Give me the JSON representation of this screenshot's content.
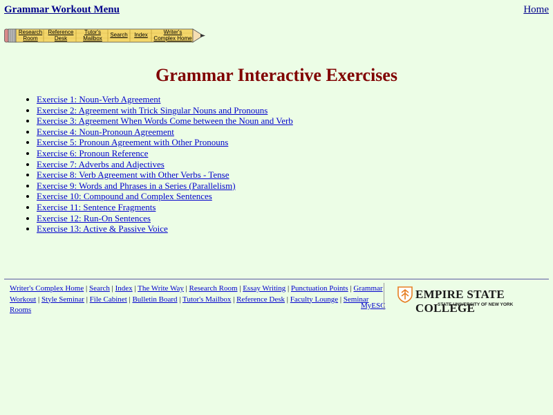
{
  "header": {
    "menu_title": "Grammar Workout Menu",
    "home_link": "Home"
  },
  "pencil_nav": {
    "items": [
      {
        "label": "Research Room"
      },
      {
        "label": "Reference Desk"
      },
      {
        "label": "Tutor's Mailbox"
      },
      {
        "label": "Search"
      },
      {
        "label": "Index"
      },
      {
        "label": "Writer's Complex Home"
      }
    ]
  },
  "main": {
    "title": "Grammar Interactive Exercises",
    "exercises": [
      "Exercise 1: Noun-Verb Agreement",
      "Exercise 2: Agreement with Trick Singular Nouns and Pronouns",
      "Exercise 3: Agreement When Words Come between the Noun and Verb",
      "Exercise 4: Noun-Pronoun Agreement",
      "Exercise 5: Pronoun Agreement with Other Pronouns",
      "Exercise 6: Pronoun Reference",
      "Exercise 7: Adverbs and Adjectives",
      "Exercise 8: Verb Agreement with Other Verbs - Tense",
      "Exercise 9: Words and Phrases in a Series (Parallelism)",
      "Exercise 10: Compound and Complex Sentences",
      "Exercise 11: Sentence Fragments",
      "Exercise 12: Run-On Sentences",
      "Exercise 13: Active & Passive Voice"
    ]
  },
  "footer": {
    "links": [
      "Writer's Complex Home",
      "Search",
      "Index",
      "The Write Way",
      "Research Room",
      "Essay Writing",
      "Punctuation Points",
      "Grammar Workout",
      "Style Seminar",
      "File Cabinet",
      "Bulletin Board",
      "Tutor's Mailbox",
      "Reference Desk",
      "Faculty Lounge",
      "Seminar Rooms"
    ],
    "myesc": "MyESC",
    "logo": {
      "name": "EMPIRE STATE COLLEGE",
      "sub": "STATE UNIVERSITY OF NEW YORK",
      "icon": "esc-shield-icon"
    }
  },
  "colors": {
    "background": "#ecfde6",
    "title": "#800000",
    "link": "#0000cc",
    "pencil_body": "#f3d66a",
    "logo_accent": "#e67e22"
  }
}
